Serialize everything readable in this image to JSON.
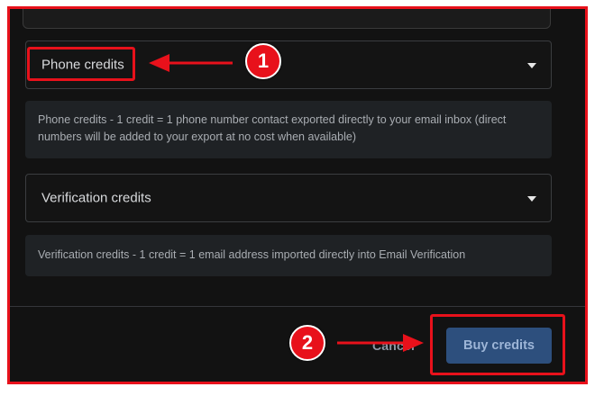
{
  "dialog": {
    "phone_select": {
      "label": "Phone credits"
    },
    "phone_info": "Phone credits - 1 credit = 1 phone number contact exported directly to your email inbox (direct numbers will be added to your export at no cost when available)",
    "verification_select": {
      "label": "Verification credits"
    },
    "verification_info": "Verification credits - 1 credit = 1 email address imported directly into Email Verification",
    "cancel_label": "Cancel",
    "buy_label": "Buy credits"
  },
  "annotations": {
    "step1": "1",
    "step2": "2",
    "highlight_color": "#e8111b"
  },
  "colors": {
    "dialog_bg": "#121212",
    "info_bg": "#1f2225",
    "primary_button": "#2d4f7d"
  }
}
